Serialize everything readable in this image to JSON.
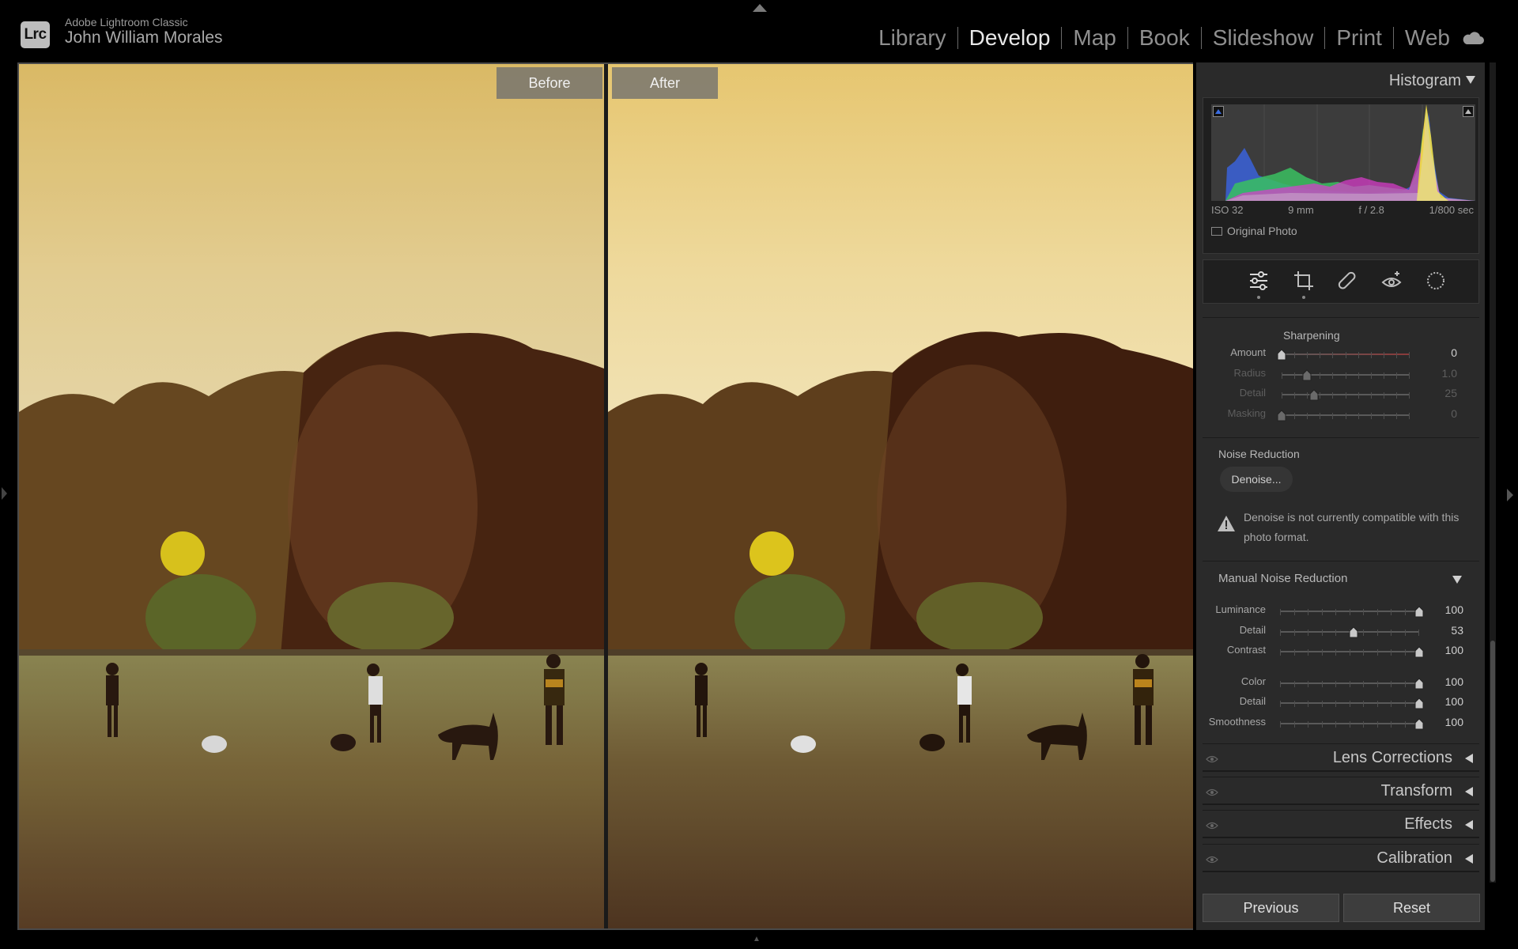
{
  "app": {
    "logo": "Lrc",
    "name": "Adobe Lightroom Classic",
    "user": "John William Morales"
  },
  "modules": [
    {
      "label": "Library",
      "active": false
    },
    {
      "label": "Develop",
      "active": true
    },
    {
      "label": "Map",
      "active": false
    },
    {
      "label": "Book",
      "active": false
    },
    {
      "label": "Slideshow",
      "active": false
    },
    {
      "label": "Print",
      "active": false
    },
    {
      "label": "Web",
      "active": false
    }
  ],
  "icons": {
    "cloud": "cloud-icon",
    "tools": [
      "edit-sliders-icon",
      "crop-icon",
      "healing-icon",
      "red-eye-icon",
      "masking-icon"
    ]
  },
  "compare": {
    "before_label": "Before",
    "after_label": "After"
  },
  "histogram": {
    "title": "Histogram",
    "exif": {
      "iso": "ISO 32",
      "focal": "9 mm",
      "aperture": "f / 2.8",
      "shutter": "1/800 sec"
    },
    "original_photo_label": "Original Photo"
  },
  "sharpening": {
    "title": "Sharpening",
    "sliders": [
      {
        "label": "Amount",
        "value": "0",
        "fraction": 0.0,
        "enabled": true
      },
      {
        "label": "Radius",
        "value": "1.0",
        "fraction": 0.2,
        "enabled": false
      },
      {
        "label": "Detail",
        "value": "25",
        "fraction": 0.25,
        "enabled": false
      },
      {
        "label": "Masking",
        "value": "0",
        "fraction": 0.0,
        "enabled": false
      }
    ]
  },
  "noise_reduction": {
    "title": "Noise Reduction",
    "denoise_button": "Denoise...",
    "warning": "Denoise is not currently compatible with this photo format."
  },
  "manual_nr": {
    "title": "Manual Noise Reduction",
    "sliders": [
      {
        "label": "Luminance",
        "value": "100",
        "fraction": 1.0
      },
      {
        "label": "Detail",
        "value": "53",
        "fraction": 0.53
      },
      {
        "label": "Contrast",
        "value": "100",
        "fraction": 1.0
      },
      {
        "label": "Color",
        "value": "100",
        "fraction": 1.0
      },
      {
        "label": "Detail",
        "value": "100",
        "fraction": 1.0
      },
      {
        "label": "Smoothness",
        "value": "100",
        "fraction": 1.0
      }
    ]
  },
  "collapsed_panels": [
    "Lens Corrections",
    "Transform",
    "Effects",
    "Calibration"
  ],
  "buttons": {
    "previous": "Previous",
    "reset": "Reset"
  }
}
